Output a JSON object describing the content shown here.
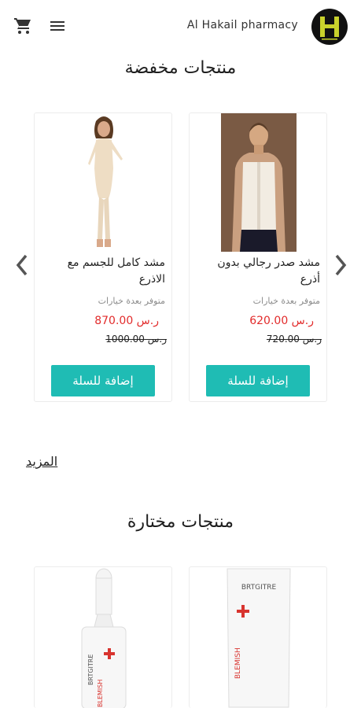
{
  "header": {
    "store_name": "Al Hakail pharmacy",
    "cart_icon": "shopping-cart-icon",
    "menu_icon": "hamburger-menu-icon",
    "logo_letter": "H",
    "logo_color": "#c9d22c"
  },
  "discounted": {
    "title": "منتجات مخفضة",
    "products": [
      {
        "name": "مشد صدر رجالي بدون أذرع",
        "availability": "متوفر بعدة خيارات",
        "price": "ر.س 620.00",
        "old_price": "ر.س 720.00",
        "button": "إضافة للسلة"
      },
      {
        "name": "مشد كامل للجسم مع الاذرع",
        "availability": "متوفر بعدة خيارات",
        "price": "ر.س 870.00",
        "old_price": "ر.س 1000.00",
        "button": "إضافة للسلة"
      }
    ],
    "more_link": "المزيد"
  },
  "featured": {
    "title": "منتجات مختارة",
    "products": [
      {
        "brand": "BRTGITRE",
        "product_label": "BLEMISH"
      },
      {
        "brand": "BRTGITRE",
        "product_label": "BLEMISH"
      }
    ]
  },
  "colors": {
    "accent": "#1fbcb4",
    "price": "#e22b2b"
  }
}
